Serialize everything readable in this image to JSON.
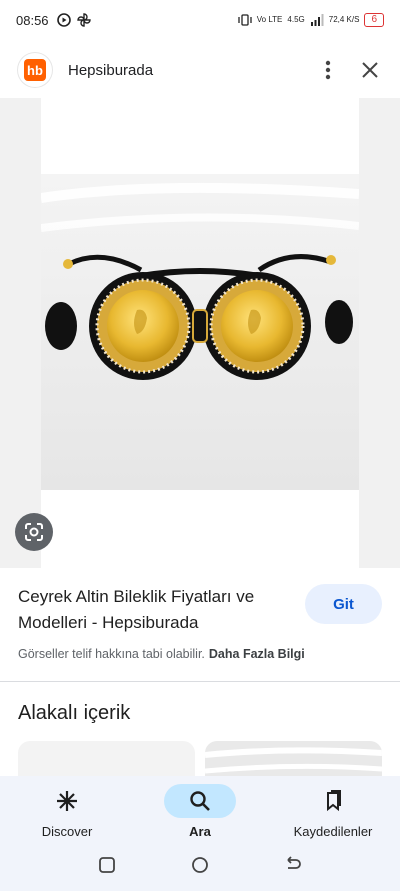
{
  "status_bar": {
    "time": "08:56",
    "network": "Vo LTE",
    "signal": "4.5G",
    "speed": "72,4 K/S",
    "battery": "6"
  },
  "header": {
    "logo_text": "hb",
    "site_name": "Hepsiburada"
  },
  "result": {
    "title": "Ceyrek Altin Bileklik Fiyatları ve Modelleri - Hepsiburada",
    "open_button": "Git",
    "copyright": "Görseller telif hakkına tabi olabilir.",
    "more_info": "Daha Fazla Bilgi"
  },
  "related": {
    "title": "Alakalı içerik"
  },
  "bottom_nav": {
    "items": [
      {
        "label": "Discover",
        "icon": "asterisk-icon"
      },
      {
        "label": "Ara",
        "icon": "search-icon"
      },
      {
        "label": "Kaydedilenler",
        "icon": "bookmarks-icon"
      }
    ],
    "active": "Ara"
  },
  "colors": {
    "brand": "#ff6000",
    "accent": "#0b57d0",
    "active_pill": "#c2e7ff"
  }
}
